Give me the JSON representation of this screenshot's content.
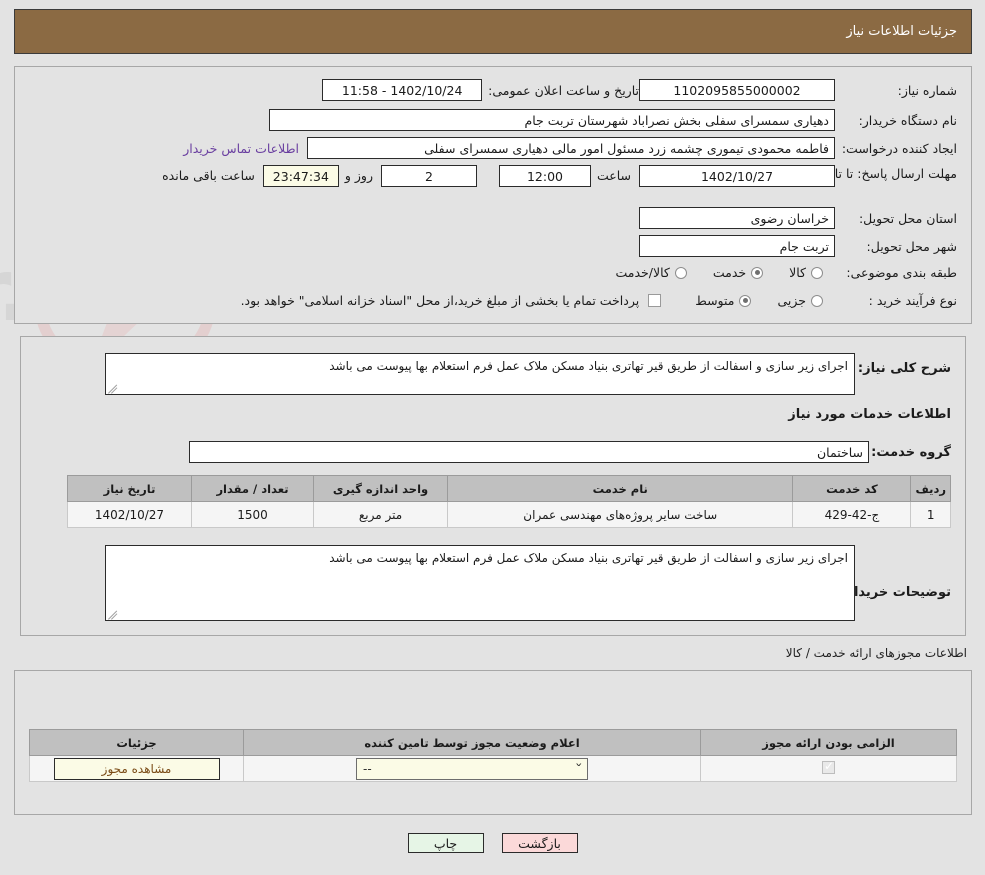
{
  "header": {
    "title": "جزئیات اطلاعات نیاز"
  },
  "form": {
    "need_number_label": "شماره نیاز:",
    "need_number_value": "1102095855000002",
    "announce_datetime_label": "تاریخ و ساعت اعلان عمومی:",
    "announce_datetime_value": "1402/10/24 - 11:58",
    "buyer_org_label": "نام دستگاه خریدار:",
    "buyer_org_value": "دهیاری سمسرای سفلی بخش نصراباد شهرستان تربت جام",
    "requester_label": "ایجاد کننده درخواست:",
    "requester_value": "فاطمه محمودی تیموری چشمه زرد مسئول امور مالی دهیاری سمسرای سفلی",
    "contact_link": "اطلاعات تماس خریدار",
    "deadline_label": "مهلت ارسال پاسخ: تا تاریخ:",
    "deadline_date": "1402/10/27",
    "deadline_time_label": "ساعت",
    "deadline_time": "12:00",
    "days_remaining": "2",
    "days_label": "روز و",
    "countdown": "23:47:34",
    "countdown_suffix": "ساعت باقی مانده",
    "province_label": "استان محل تحویل:",
    "province_value": "خراسان رضوی",
    "city_label": "شهر محل تحویل:",
    "city_value": "تربت جام",
    "category_label": "طبقه بندی موضوعی:",
    "category_options": [
      {
        "label": "کالا",
        "selected": false
      },
      {
        "label": "خدمت",
        "selected": true
      },
      {
        "label": "کالا/خدمت",
        "selected": false
      }
    ],
    "process_label": "نوع فرآیند خرید :",
    "process_options": [
      {
        "label": "جزیی",
        "selected": false
      },
      {
        "label": "متوسط",
        "selected": true
      }
    ],
    "treasury_checkbox_checked": false,
    "treasury_text": "پرداخت تمام یا بخشی از مبلغ خرید،از محل \"اسناد خزانه اسلامی\" خواهد بود."
  },
  "middle": {
    "general_desc_label": "شرح کلی نیاز:",
    "general_desc_value": "اجرای زیر سازی و اسفالت از طریق قیر تهاتری بنیاد مسکن ملاک عمل فرم استعلام بها پیوست می باشد",
    "services_heading": "اطلاعات خدمات مورد نیاز",
    "service_group_label": "گروه خدمت:",
    "service_group_value": "ساختمان",
    "table": {
      "headers": [
        "ردیف",
        "کد خدمت",
        "نام خدمت",
        "واحد اندازه گیری",
        "تعداد / مقدار",
        "تاریخ نیاز"
      ],
      "rows": [
        [
          "1",
          "ج-42-429",
          "ساخت سایر پروژه‌های مهندسی عمران",
          "متر مربع",
          "1500",
          "1402/10/27"
        ]
      ]
    },
    "buyer_notes_label": "توضیحات خریدار:",
    "buyer_notes_value": "اجرای زیر سازی و اسفالت از طریق قیر تهاتری بنیاد مسکن ملاک عمل فرم استعلام بها پیوست می باشد"
  },
  "permits": {
    "heading": "اطلاعات مجوزهای ارائه خدمت / کالا",
    "table": {
      "headers": [
        "الزامی بودن ارائه مجوز",
        "اعلام وضعیت مجوز توسط تامین کننده",
        "جزئیات"
      ],
      "rows": [
        {
          "required_checked": true,
          "status_value": "--",
          "details_button": "مشاهده مجوز"
        }
      ]
    }
  },
  "footer": {
    "print_label": "چاپ",
    "back_label": "بازگشت"
  },
  "colors": {
    "header_bar": "#8b6a43",
    "page_background": "#e3e3e3",
    "link": "#6a3fa0",
    "table_header": "#c0c0c0",
    "cream_field": "#fbfbe6",
    "print_button": "#e6f5e6",
    "back_button": "#fbd9d9"
  }
}
